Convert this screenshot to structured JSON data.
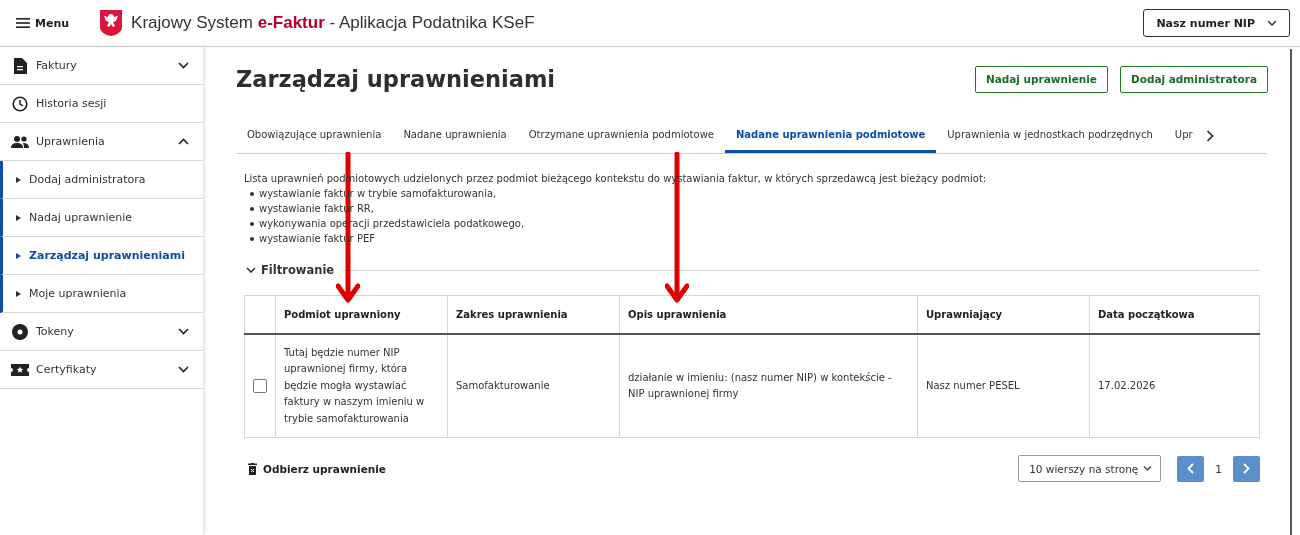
{
  "header": {
    "menu_label": "Menu",
    "title_prefix": "Krajowy System ",
    "title_brand": "e-Faktur",
    "title_suffix": " - Aplikacja Podatnika KSeF",
    "context_select": "Nasz numer NIP"
  },
  "sidebar": {
    "items": [
      {
        "label": "Faktury",
        "expanded": false
      },
      {
        "label": "Historia sesji"
      },
      {
        "label": "Uprawnienia",
        "expanded": true,
        "children": [
          {
            "label": "Dodaj administratora",
            "selected": false
          },
          {
            "label": "Nadaj uprawnienie",
            "selected": false
          },
          {
            "label": "Zarządzaj uprawnieniami",
            "selected": true
          },
          {
            "label": "Moje uprawnienia",
            "selected": false
          }
        ]
      },
      {
        "label": "Tokeny",
        "expanded": false
      },
      {
        "label": "Certyfikaty",
        "expanded": false
      }
    ]
  },
  "page": {
    "title": "Zarządzaj uprawnieniami",
    "buttons": [
      "Nadaj uprawnienie",
      "Dodaj administratora"
    ]
  },
  "tabs": [
    {
      "label": "Obowiązujące uprawnienia",
      "selected": false
    },
    {
      "label": "Nadane uprawnienia",
      "selected": false
    },
    {
      "label": "Otrzymane uprawnienia podmiotowe",
      "selected": false
    },
    {
      "label": "Nadane uprawnienia podmiotowe",
      "selected": true
    },
    {
      "label": "Uprawnienia w jednostkach podrzędnych",
      "selected": false
    },
    {
      "label": "Upr",
      "selected": false
    }
  ],
  "description": {
    "intro": "Lista uprawnień podmiotowych udzielonych przez podmiot bieżącego kontekstu do wystawiania faktur, w których sprzedawcą jest bieżący podmiot:",
    "bullets": [
      "wystawianie faktur w trybie samofakturowania,",
      "wystawianie faktur RR,",
      "wykonywania operacji przedstawiciela podatkowego,",
      "wystawianie faktur PEF"
    ]
  },
  "filter": {
    "label": "Filtrowanie",
    "expanded": true
  },
  "table": {
    "columns": [
      "Podmiot uprawniony",
      "Zakres uprawnienia",
      "Opis uprawnienia",
      "Uprawniający",
      "Data początkowa"
    ],
    "rows": [
      {
        "checked": false,
        "cells": [
          "Tutaj będzie numer NIP uprawnionej firmy, która będzie mogła wystawiać faktury w naszym imieniu w trybie samofakturowania",
          "Samofakturowanie",
          "działanie w imieniu: (nasz numer NIP) w kontekście - NIP uprawnionej firmy",
          "Nasz numer PESEL",
          "17.02.2026"
        ]
      }
    ]
  },
  "footer": {
    "revoke_button": "Odbierz uprawnienie",
    "page_size": "10 wierszy na stronę",
    "page": "1"
  },
  "annotations": [
    {
      "kind": "arrow",
      "color": "#e00000"
    },
    {
      "kind": "arrow",
      "color": "#e00000"
    }
  ]
}
